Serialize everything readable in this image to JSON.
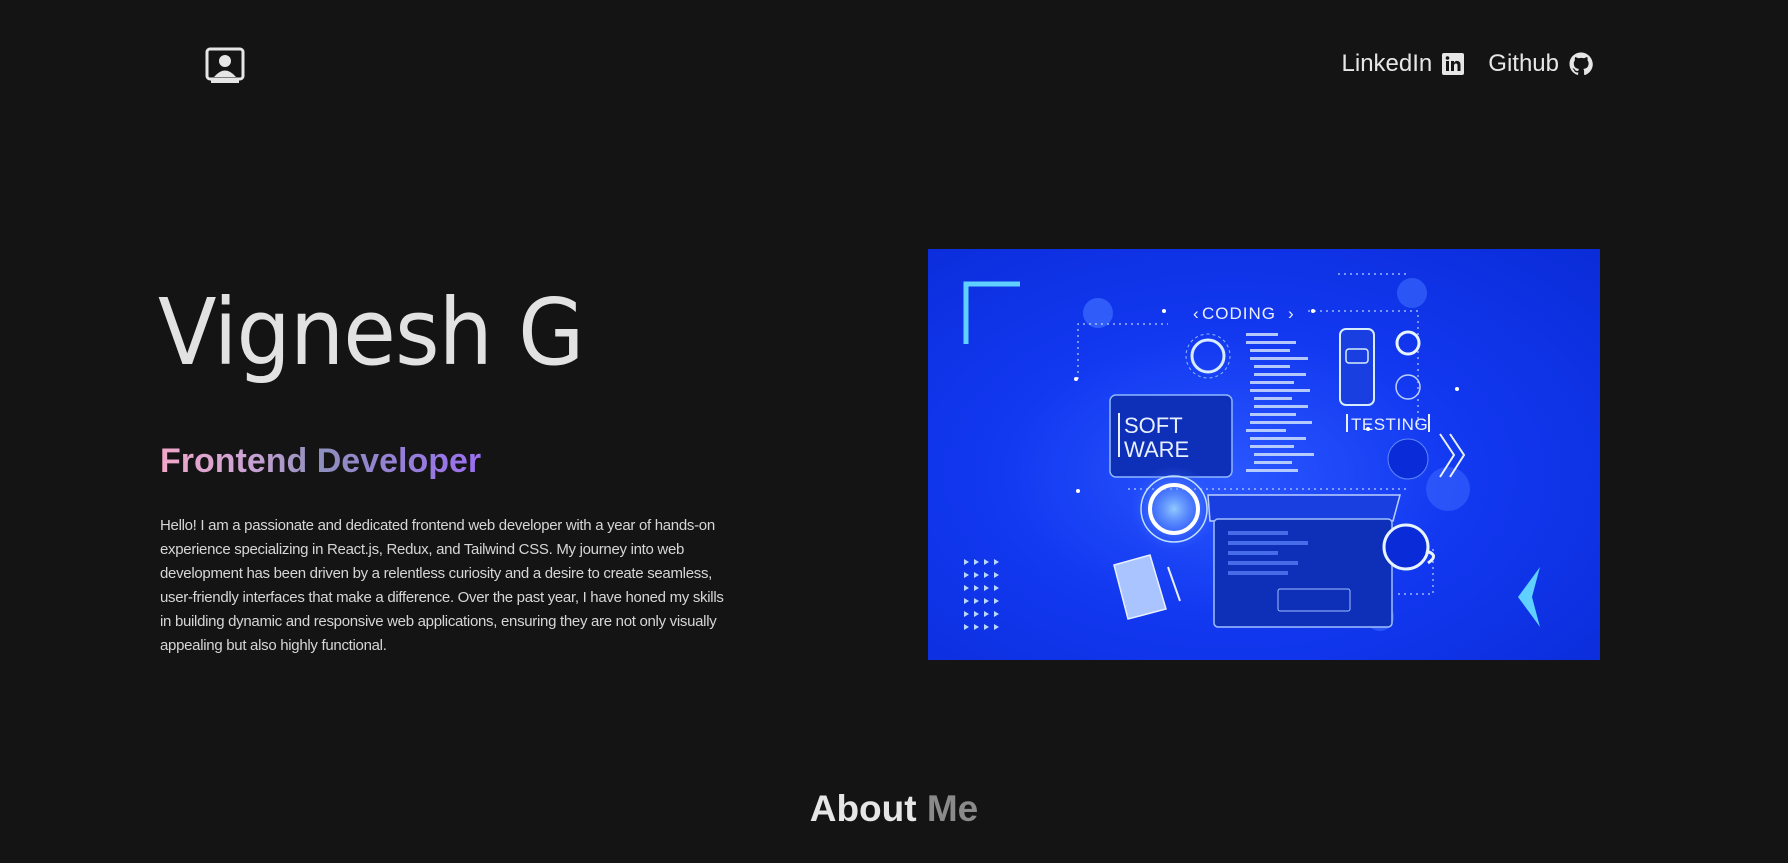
{
  "nav": {
    "logo_icon": "person-card-icon",
    "links": [
      {
        "label": "LinkedIn",
        "icon": "linkedin-icon"
      },
      {
        "label": "Github",
        "icon": "github-icon"
      }
    ]
  },
  "hero": {
    "name": "Vignesh G",
    "role": "Frontend Developer",
    "description": "Hello! I am a passionate and dedicated frontend web developer with a year of hands-on experience specializing in React.js, Redux, and Tailwind CSS. My journey into web development has been driven by a relentless curiosity and a desire to create seamless, user-friendly interfaces that make a difference. Over the past year, I have honed my skills in building dynamic and responsive web applications, ensuring they are not only visually appealing but also highly functional.",
    "illustration": {
      "coding_label": "CODING",
      "software_label_1": "SOFT",
      "software_label_2": "WARE",
      "testing_label": "TESTING"
    }
  },
  "about": {
    "title_word_1": "About",
    "title_word_2": "Me"
  },
  "colors": {
    "background": "#141414",
    "accent_blue": "#1238f0",
    "role_gradient": [
      "#f3a7c9",
      "#8f8fbd",
      "#9b6ff0"
    ]
  }
}
